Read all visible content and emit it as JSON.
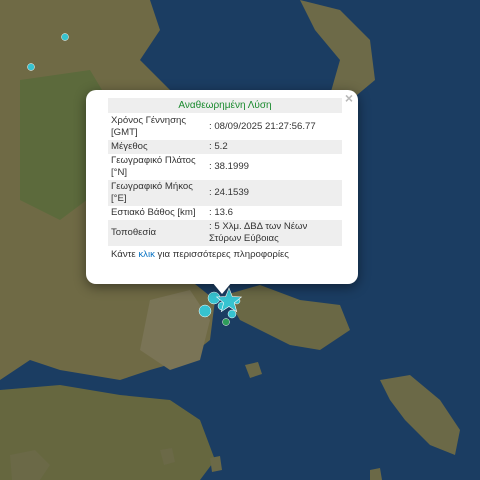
{
  "popup": {
    "title": "Αναθεωρημένη Λύση",
    "close_symbol": "×",
    "rows": [
      {
        "label": "Χρόνος Γέννησης [GMT]",
        "value": ": 08/09/2025 21:27:56.77"
      },
      {
        "label": "Μέγεθος",
        "value": ": 5.2"
      },
      {
        "label": "Γεωγραφικό Πλάτος [°N]",
        "value": ": 38.1999"
      },
      {
        "label": "Γεωγραφικό Μήκος [°E]",
        "value": ": 24.1539"
      },
      {
        "label": "Εστιακό Βάθος [km]",
        "value": ": 13.6"
      },
      {
        "label": "Τοποθεσία",
        "value": ": 5 Χλμ. ΔΒΔ των Νέων Στύρων Εύβοιας"
      }
    ],
    "more_before": "Κάντε ",
    "more_link": "κλικ",
    "more_after": " για περισσότερες πληροφορίες"
  },
  "colors": {
    "sea": "#1b3d62",
    "land": "#6f6a45",
    "event_marker": "#36c3d0",
    "older_event_marker": "#2e9c5a",
    "title_green": "#1a8a2e",
    "link_blue": "#0b74c4"
  },
  "markers": [
    {
      "name": "main-event-star-marker",
      "shape": "star"
    },
    {
      "name": "aftershock-marker",
      "shape": "circle"
    },
    {
      "name": "aftershock-marker",
      "shape": "circle"
    },
    {
      "name": "aftershock-marker",
      "shape": "circle"
    },
    {
      "name": "aftershock-marker",
      "shape": "circle"
    },
    {
      "name": "aftershock-marker",
      "shape": "circle"
    },
    {
      "name": "older-event-marker",
      "shape": "circle"
    },
    {
      "name": "remote-event-marker",
      "shape": "circle"
    },
    {
      "name": "remote-event-marker",
      "shape": "circle"
    }
  ]
}
